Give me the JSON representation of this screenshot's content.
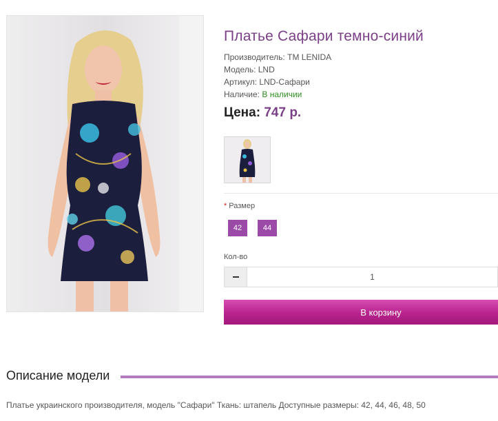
{
  "product": {
    "title": "Платье Сафари темно-синий",
    "manufacturer_label": "Производитель:",
    "manufacturer": "TM LENIDA",
    "model_label": "Модель:",
    "model": "LND",
    "sku_label": "Артикул:",
    "sku": "LND-Сафари",
    "availability_label": "Наличие:",
    "availability": "В наличии",
    "price_label": "Цена:",
    "price": "747 р."
  },
  "options": {
    "required_mark": "*",
    "size_label": "Размер",
    "sizes": [
      "42",
      "44"
    ]
  },
  "quantity": {
    "label": "Кол-во",
    "value": "1"
  },
  "cart_button": "В корзину",
  "description": {
    "heading": "Описание модели",
    "text": "Платье украинского производителя, модель \"Сафари\" Ткань: штапель Доступные размеры: 42, 44, 46, 48, 50"
  },
  "colors": {
    "accent_purple": "#7a3f86",
    "size_button": "#9b4aa8",
    "cart_button": "#b8238d",
    "in_stock": "#2e8b1f",
    "required": "#d61f1f"
  }
}
